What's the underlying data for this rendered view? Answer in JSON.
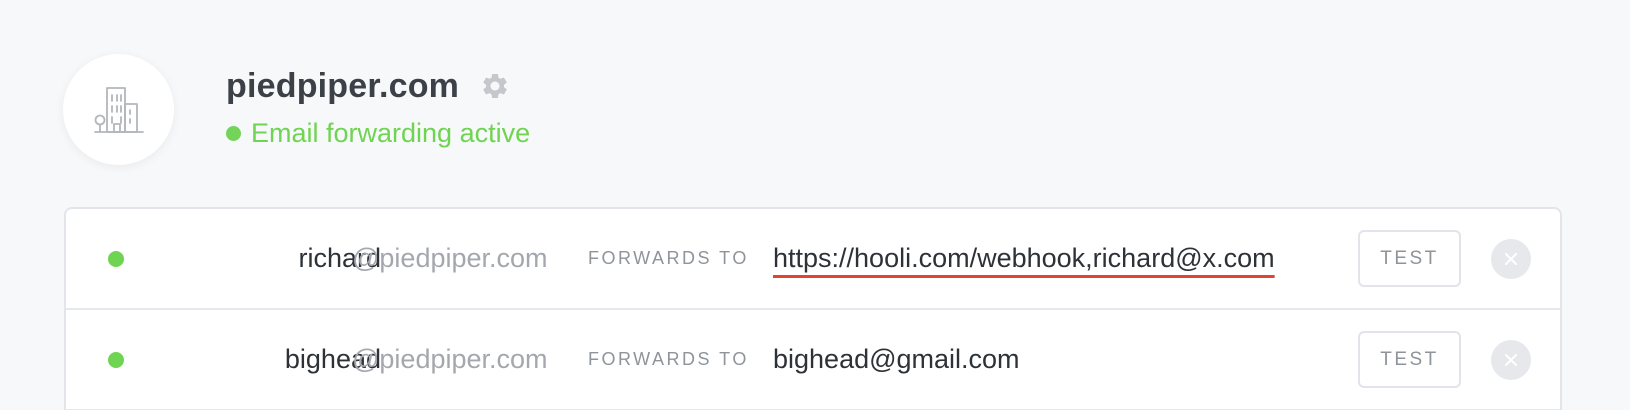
{
  "domain": {
    "name": "piedpiper.com",
    "status": "Email forwarding active",
    "status_color": "#6fd451",
    "avatar_icon": "building-icon",
    "settings_icon": "gear-icon"
  },
  "forwards": {
    "label": "FORWARDS TO",
    "test_label": "TEST",
    "remove_icon": "close-icon",
    "rows": [
      {
        "alias": "richard",
        "domain": "@piedpiper.com",
        "destination": "https://hooli.com/webhook,richard@x.com",
        "active": true,
        "invalid": true
      },
      {
        "alias": "bighead",
        "domain": "@piedpiper.com",
        "destination": "bighead@gmail.com",
        "active": true,
        "invalid": false
      }
    ]
  },
  "colors": {
    "active_green": "#6fd451",
    "error_red": "#e2442f",
    "text_dark": "#2d3238",
    "text_muted": "#a4a8ae"
  }
}
